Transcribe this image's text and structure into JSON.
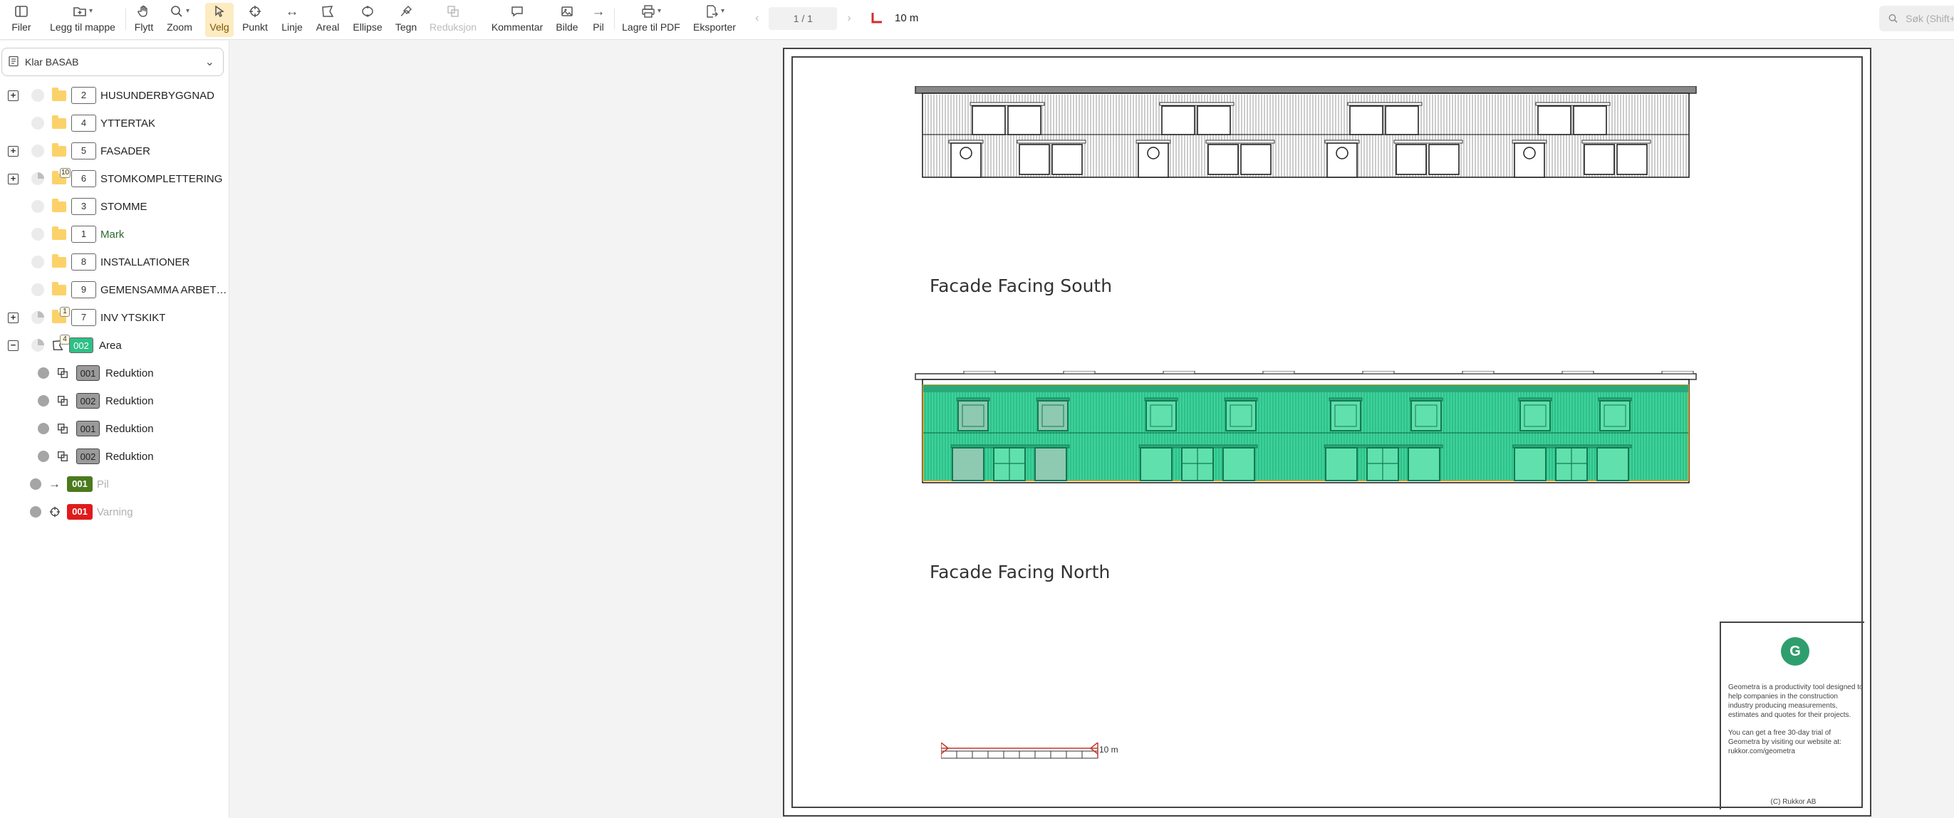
{
  "toolbar": {
    "files": "Filer",
    "add_to_folder": "Legg til mappe",
    "move": "Flytt",
    "zoom": "Zoom",
    "select": "Velg",
    "point": "Punkt",
    "line": "Linje",
    "area": "Areal",
    "ellipse": "Ellipse",
    "draw": "Tegn",
    "reduction": "Reduksjon",
    "comment": "Kommentar",
    "image": "Bilde",
    "arrow": "Pil",
    "save_pdf": "Lagre til PDF",
    "export": "Eksporter",
    "page_indicator": "1 / 1",
    "scale": "10 m",
    "search_placeholder": "Søk (Shift+F)"
  },
  "sidebar": {
    "project": "Klar BASAB",
    "rows": [
      {
        "code": "2",
        "label": "HUSUNDERBYGGNAD"
      },
      {
        "code": "4",
        "label": "YTTERTAK"
      },
      {
        "code": "5",
        "label": "FASADER"
      },
      {
        "code": "6",
        "label": "STOMKOMPLETTERING",
        "count": "10"
      },
      {
        "code": "3",
        "label": "STOMME"
      },
      {
        "code": "1",
        "label": "Mark"
      },
      {
        "code": "8",
        "label": "INSTALLATIONER"
      },
      {
        "code": "9",
        "label": "GEMENSAMMA ARBETEN"
      },
      {
        "code": "7",
        "label": "INV YTSKIKT",
        "count": "1"
      },
      {
        "code": "002",
        "label": "Area",
        "count": "4"
      },
      {
        "code": "001",
        "label": "Reduktion"
      },
      {
        "code": "002",
        "label": "Reduktion"
      },
      {
        "code": "001",
        "label": "Reduktion"
      },
      {
        "code": "002",
        "label": "Reduktion"
      },
      {
        "code": "001",
        "label": "Pil"
      },
      {
        "code": "001",
        "label": "Varning"
      }
    ]
  },
  "drawing": {
    "south_title": "Facade Facing South",
    "north_title": "Facade Facing North",
    "scalebar_label": "10 m",
    "titleblock": {
      "logo_letter": "G",
      "text1": "Geometra is a productivity tool designed to help companies in the construction industry producing measurements, estimates and quotes for their projects.",
      "text2": "You can get a free 30-day trial of Geometra by visiting our website at: rukkor.com/geometra",
      "copyright": "(C) Rukkor AB"
    }
  },
  "colors": {
    "active_tool": "#fdebc2",
    "area_fill": "#3dd39b",
    "area_edge": "#c9a227",
    "code_grey": "#9a9a9a",
    "code_area": "#2fbf87",
    "code_arrow": "#4b7a1e",
    "code_warning": "#e01b1b",
    "scale_red": "#c0392b"
  }
}
